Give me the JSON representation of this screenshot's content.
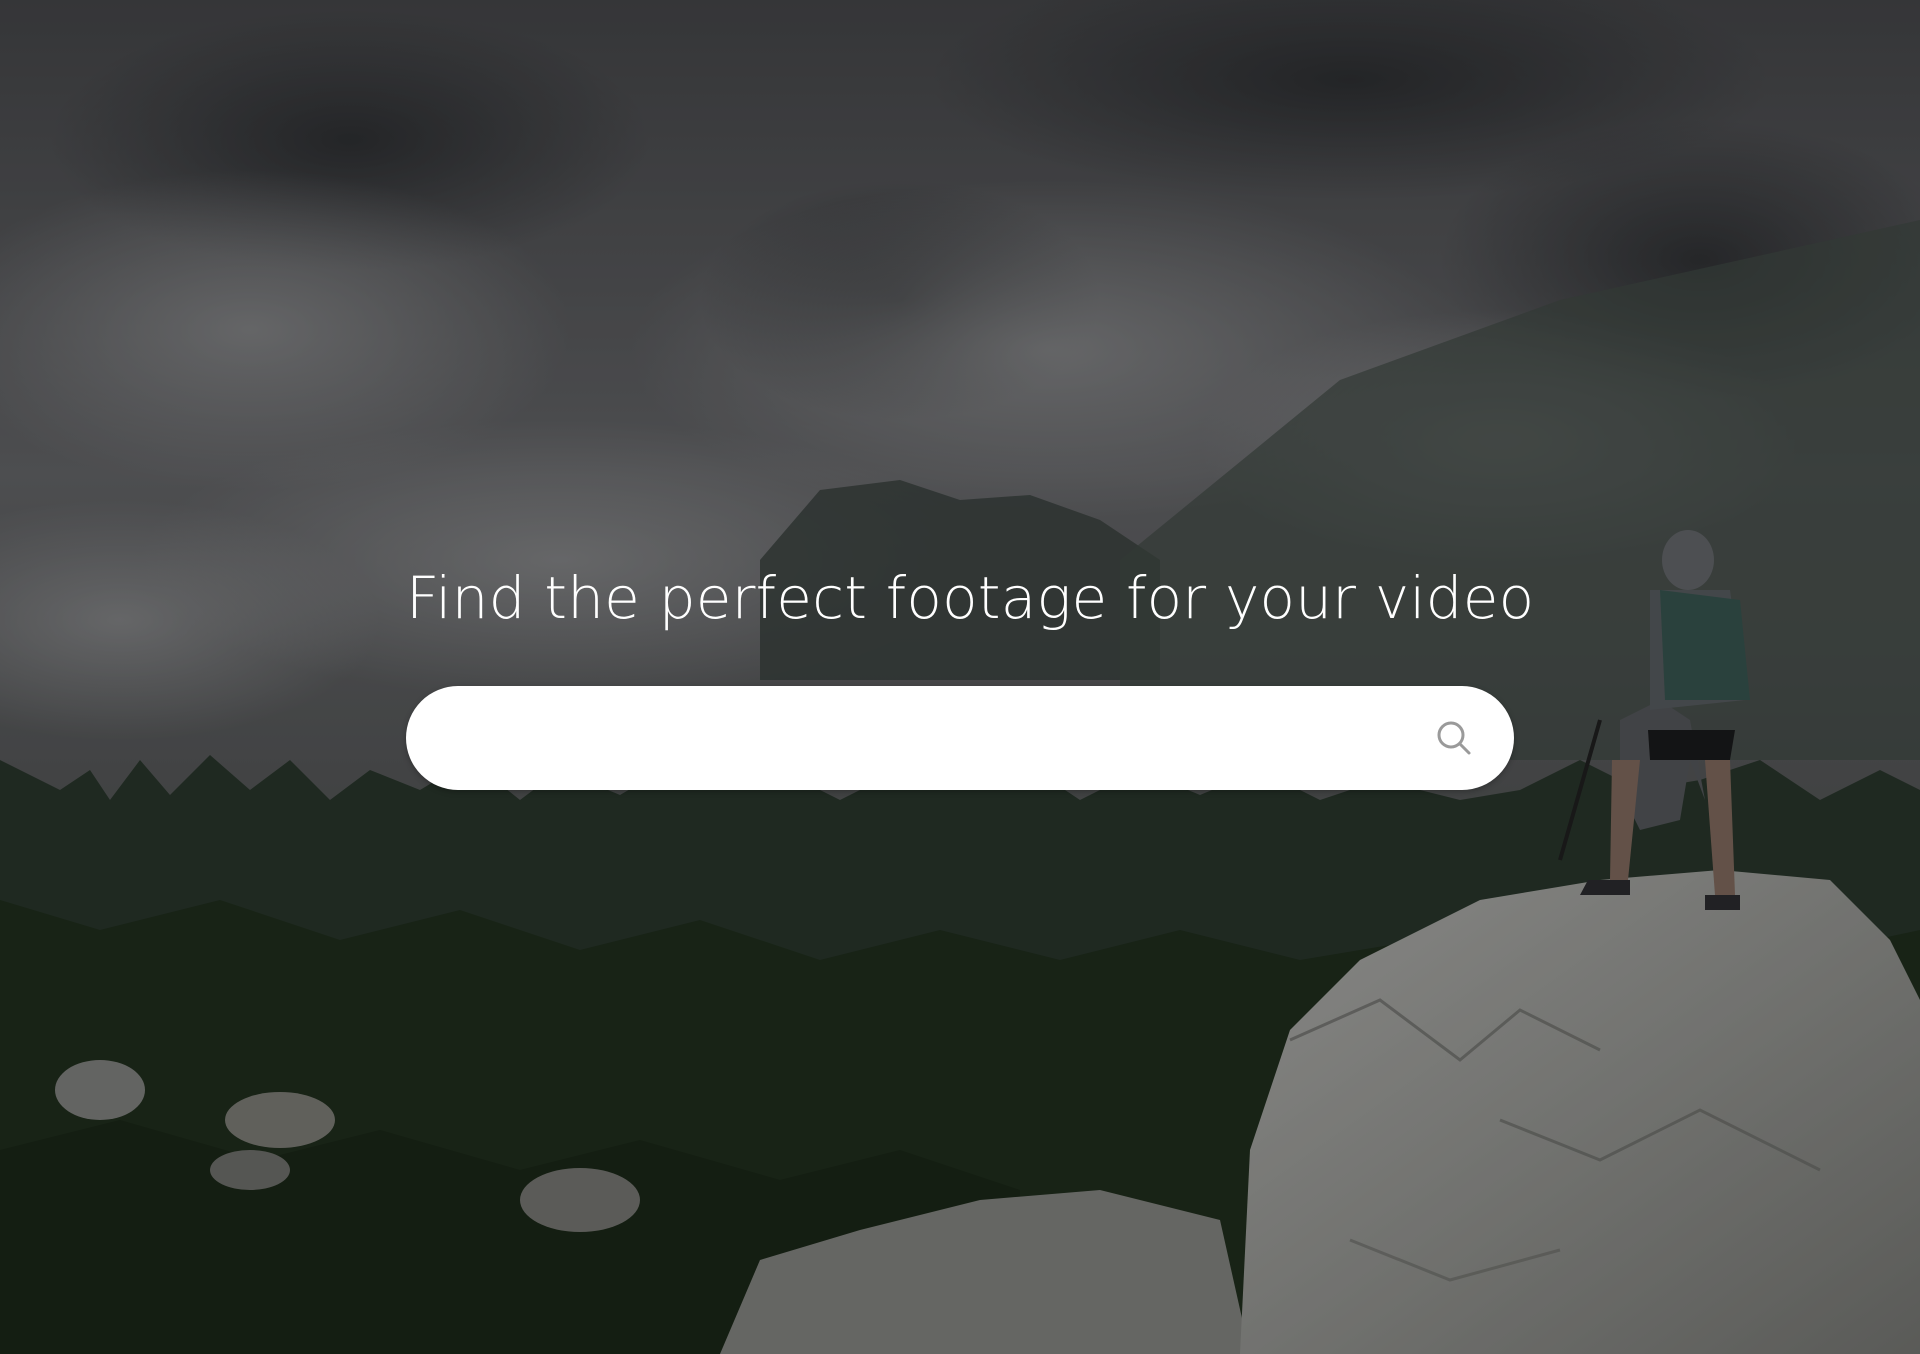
{
  "hero": {
    "headline": "Find the perfect footage for your video",
    "background_icon": "mountain-hiker-photo"
  },
  "search": {
    "value": "",
    "placeholder": "",
    "icon": "search-icon"
  },
  "colors": {
    "headline": "#ffffff",
    "search_bg": "#ffffff",
    "search_icon": "#9a9a9a"
  }
}
